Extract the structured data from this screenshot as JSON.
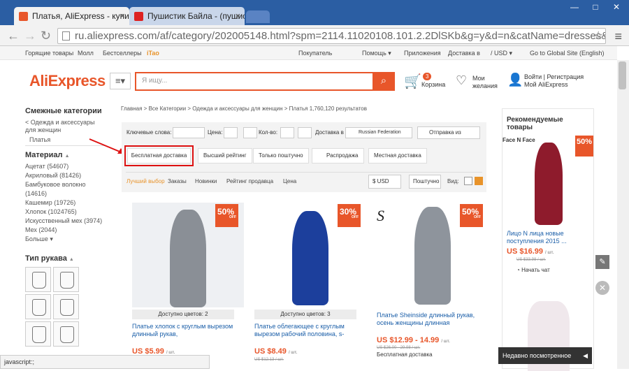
{
  "tabs": [
    {
      "label": "Платья, AliExpress - купить"
    },
    {
      "label": "Пушистик Байла - (пушистик"
    }
  ],
  "address": {
    "url": "ru.aliexpress.com/af/category/202005148.html?spm=2114.11020108.101.2.2DlSKb&g=y&d=n&catName=dresses&"
  },
  "topbar": {
    "hot": "Горящие товары",
    "my": "Молл",
    "best": "Бестселлеры",
    "itao": "iTao",
    "protect": "Покупатель",
    "help": "Помощь ▾",
    "apps": "Приложения",
    "ship": "Доставка в",
    "currency": "/ USD ▾",
    "global": "Go to Global Site (English)"
  },
  "header": {
    "logo": "AliExpress",
    "search_placeholder": "Я ищу...",
    "cart_count": "3",
    "cart_label": "Корзина",
    "wish_label": "Мои желания",
    "signin": "Войти | Регистрация",
    "my_ali": "Мой AliExpress"
  },
  "sidebar": {
    "related_title": "Смежные категории",
    "back": "< Одежда и аксессуары для женщин",
    "current": "Платья",
    "material_title": "Материал",
    "materials": [
      "Ацетат (54607)",
      "Акриловый (81426)",
      "Бамбуковое волокно (14616)",
      "Кашемир (19726)",
      "Хлопок (1024765)",
      "Искусственный мех (3974)",
      "Мех (2044)"
    ],
    "more": "Больше ▾",
    "sleeve_title": "Тип рукава"
  },
  "breadcrumb": "Главная > Все Категории > Одежда и аксессуары для женщин > Платья 1,760,120 результатов",
  "filters": {
    "keywords": "Ключевые слова:",
    "price": "Цена:",
    "qty": "Кол-во:",
    "ship_to": "Доставка в",
    "country": "Russian Federation",
    "ship_from": "Отправка из",
    "free": "Бесплатная доставка",
    "top": "Высший рейтинг",
    "piece": "Только поштучно",
    "sale": "Распродажа",
    "local": "Местная доставка"
  },
  "sort": {
    "best": "Лучший выбор",
    "orders": "Заказы",
    "new": "Новинки",
    "seller": "Рейтинг продавца",
    "price": "Цена",
    "currency": "$ USD",
    "unit": "Поштучно",
    "view": "Вид:"
  },
  "products": [
    {
      "badge": "50",
      "colors": "Доступно цветов: 2",
      "title": "Платье хлопок с круглым вырезом длинный рукав,",
      "price": "US $5.99",
      "unit": "/ шт.",
      "color": "#8a8f96"
    },
    {
      "badge": "30",
      "colors": "Доступно цветов: 3",
      "title": "Платье облегающее с круглым вырезом рабочий половина, s-",
      "price": "US $8.49",
      "unit": "/ шт.",
      "old": "US $12.13 / шт.",
      "color": "#1c3f9c"
    },
    {
      "badge": "50",
      "colors": "",
      "title": "Платье Sheinside длинный рукав, осень женщины длинная",
      "price": "US $12.99 - 14.99",
      "unit": "/ шт.",
      "old": "US $26.00 - 29.98 / шт.",
      "ship": "Бесплатная доставка",
      "color": "#8e949c"
    }
  ],
  "recommended": {
    "title": "Рекомендуемые товары",
    "brand": "Face N Face",
    "badge": "50",
    "name": "Лицо N лица новые поступления 2015 ...",
    "price": "US $16.99",
    "unit": "/ шт.",
    "old": "US $33.98 / шт.",
    "chat": "Начать чат"
  },
  "recent": "Недавно посмотренное",
  "status": "javascript:;"
}
